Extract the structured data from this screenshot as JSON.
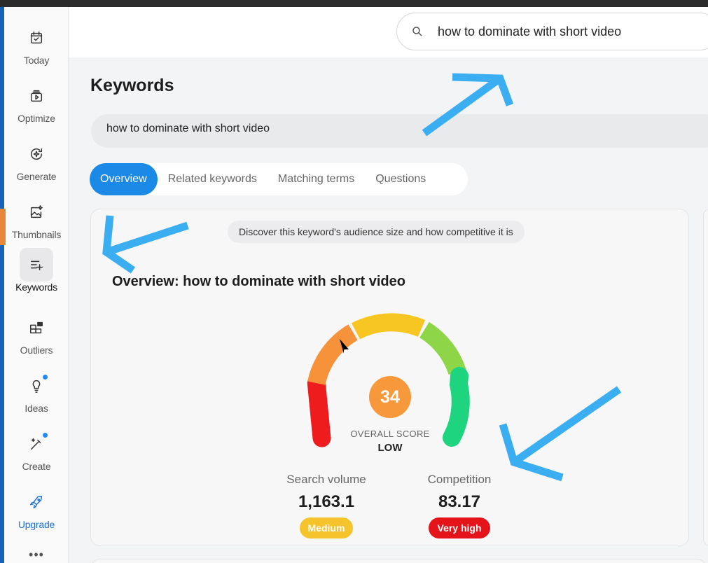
{
  "sidebar": {
    "items": [
      {
        "label": "Today",
        "icon": "calendar-icon"
      },
      {
        "label": "Optimize",
        "icon": "video-icon"
      },
      {
        "label": "Generate",
        "icon": "sparkle-refresh-icon"
      },
      {
        "label": "Thumbnails",
        "icon": "image-sparkle-icon"
      },
      {
        "label": "Keywords",
        "icon": "list-add-icon"
      },
      {
        "label": "Outliers",
        "icon": "grid-icon"
      },
      {
        "label": "Ideas",
        "icon": "lightbulb-icon"
      },
      {
        "label": "Create",
        "icon": "magic-wand-icon"
      },
      {
        "label": "Upgrade",
        "icon": "rocket-icon"
      }
    ],
    "active": "Keywords",
    "more": "•••"
  },
  "header": {
    "search_value": "how to dominate with short video"
  },
  "page": {
    "title": "Keywords",
    "keyword_value": "how to dominate with short video"
  },
  "tabs": [
    {
      "label": "Overview",
      "active": true
    },
    {
      "label": "Related keywords",
      "active": false
    },
    {
      "label": "Matching terms",
      "active": false
    },
    {
      "label": "Questions",
      "active": false
    }
  ],
  "overview": {
    "hint": "Discover this keyword's audience size and how competitive it is",
    "title": "Overview: how to dominate with short video",
    "score": "34",
    "score_caption": "OVERALL SCORE",
    "score_level": "LOW",
    "metrics": [
      {
        "label": "Search volume",
        "value": "1,163.1",
        "badge": "Medium",
        "badge_color": "#f5c32c"
      },
      {
        "label": "Competition",
        "value": "83.17",
        "badge": "Very high",
        "badge_color": "#e5141b"
      }
    ]
  },
  "colors": {
    "accent": "#1a8ae6",
    "gauge_segments": [
      "#ee1c1c",
      "#f6923a",
      "#f7c623",
      "#8fd548",
      "#1fd47e"
    ],
    "score_fill": "#f7983b",
    "annotation_arrows": "#3aaef0"
  }
}
